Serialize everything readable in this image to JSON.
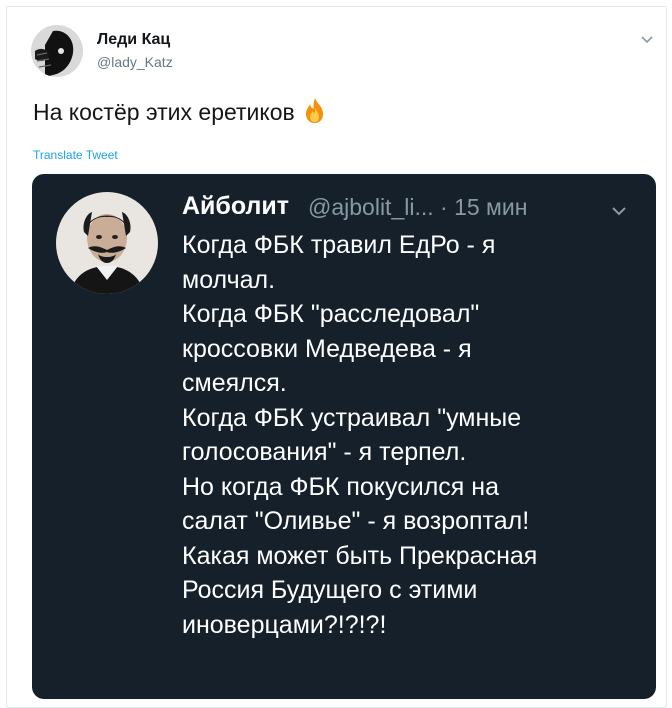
{
  "tweet": {
    "author_name": "Леди Кац",
    "author_handle": "@lady_Katz",
    "text": "На костёр этих еретиков",
    "emoji_icon": "fire-icon",
    "translate_label": "Translate Tweet"
  },
  "quoted": {
    "author_name": "Айболит",
    "author_handle": "@ajbolit_li...",
    "time": "· 15 мин",
    "lines": [
      "Когда ФБК травил ЕдРо - я",
      "молчал.",
      "Когда ФБК \"расследовал\"",
      "кроссовки Медведева - я",
      "смеялся.",
      "Когда ФБК устраивал \"умные",
      "голосования\" - я терпел.",
      "Но когда ФБК покусился на",
      "салат  \"Оливье\" - я возроптал!",
      "Какая может быть Прекрасная",
      "Россия Будущего с этими",
      "иноверцами?!?!?!"
    ]
  },
  "colors": {
    "accent": "#1da1f2",
    "dark_bg": "#15202b",
    "muted": "#657786"
  }
}
